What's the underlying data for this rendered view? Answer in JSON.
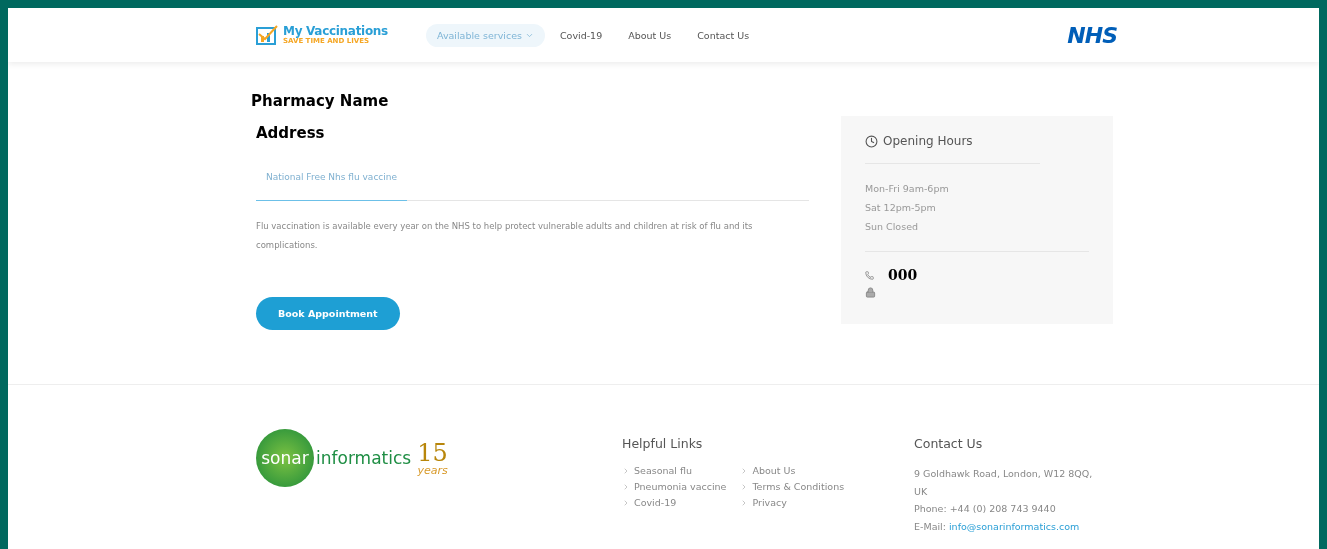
{
  "header": {
    "logo": {
      "name": "My Vaccinations",
      "tagline": "SAVE TIME AND LIVES"
    },
    "nav": [
      {
        "label": "Available services",
        "selected": true,
        "dropdown": true
      },
      {
        "label": "Covid-19",
        "selected": false,
        "dropdown": false
      },
      {
        "label": "About Us",
        "selected": false,
        "dropdown": false
      },
      {
        "label": "Contact Us",
        "selected": false,
        "dropdown": false
      }
    ],
    "partner_logo": "NHS"
  },
  "pharmacy": {
    "name": "Pharmacy Name",
    "address": "Address",
    "tabs": [
      {
        "label": "National Free Nhs flu vaccine",
        "selected": true
      }
    ],
    "description": "Flu vaccination is available every year on the NHS to help protect vulnerable adults and children at risk of flu and its complications.",
    "book_button": "Book Appointment"
  },
  "opening_hours": {
    "title": "Opening Hours",
    "hours": [
      "Mon-Fri 9am-6pm",
      "Sat 12pm-5pm",
      "Sun Closed"
    ],
    "phone": "000"
  },
  "footer": {
    "logo": {
      "left": "sonar",
      "right": "informatics",
      "badge_number": "15",
      "badge_word": "years"
    },
    "helpful_links": {
      "title": "Helpful Links",
      "columns": [
        [
          "Seasonal flu",
          "Pneumonia vaccine",
          "Covid-19"
        ],
        [
          "About Us",
          "Terms & Conditions",
          "Privacy"
        ]
      ]
    },
    "contact": {
      "title": "Contact Us",
      "address": "9 Goldhawk Road, London, W12 8QQ, UK",
      "phone": "Phone: +44 (0) 208 743 9440",
      "email_label": "E-Mail:",
      "email": "info@sonarinformatics.com"
    }
  }
}
